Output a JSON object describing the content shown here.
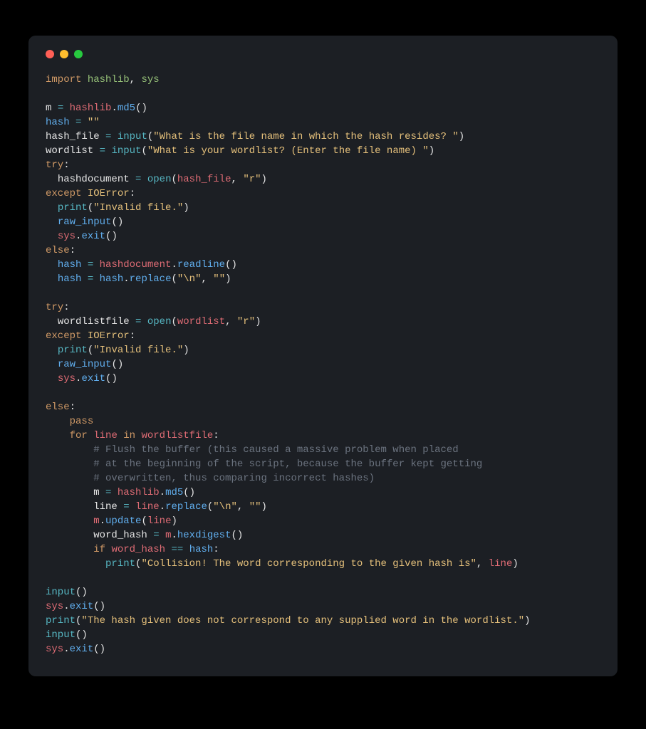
{
  "window": {
    "dots": [
      "close",
      "minimize",
      "zoom"
    ]
  },
  "code": {
    "l01_import": "import",
    "l01_mod1": "hashlib",
    "l01_mod2": "sys",
    "l03_m": "m",
    "l03_eq": "=",
    "l03_hashlib": "hashlib",
    "l03_md5": "md5",
    "l04_hash": "hash",
    "l04_eq": "=",
    "l04_str": "\"\"",
    "l05_hashfile": "hash_file",
    "l05_eq": "=",
    "l05_input": "input",
    "l05_str": "\"What is the file name in which the hash resides? \"",
    "l06_wordlist": "wordlist",
    "l06_eq": "=",
    "l06_input": "input",
    "l06_str": "\"What is your wordlist? (Enter the file name) \"",
    "l07_try": "try",
    "l08_hashdoc": "hashdocument",
    "l08_eq": "=",
    "l08_open": "open",
    "l08_arg1": "hash_file",
    "l08_arg2": "\"r\"",
    "l09_except": "except",
    "l09_ioe": "IOError",
    "l10_print": "print",
    "l10_str": "\"Invalid file.\"",
    "l11_rawinput": "raw_input",
    "l12_sys": "sys",
    "l12_exit": "exit",
    "l13_else": "else",
    "l14_hash": "hash",
    "l14_eq": "=",
    "l14_hashdoc": "hashdocument",
    "l14_readline": "readline",
    "l15_hash": "hash",
    "l15_eq": "=",
    "l15_hashref": "hash",
    "l15_replace": "replace",
    "l15_a": "\"\\n\"",
    "l15_b": "\"\"",
    "l17_try": "try",
    "l18_wlf": "wordlistfile",
    "l18_eq": "=",
    "l18_open": "open",
    "l18_arg1": "wordlist",
    "l18_arg2": "\"r\"",
    "l19_except": "except",
    "l19_ioe": "IOError",
    "l20_print": "print",
    "l20_str": "\"Invalid file.\"",
    "l21_rawinput": "raw_input",
    "l22_sys": "sys",
    "l22_exit": "exit",
    "l24_else": "else",
    "l25_pass": "pass",
    "l26_for": "for",
    "l26_line": "line",
    "l26_in": "in",
    "l26_wlf": "wordlistfile",
    "l27_com": "# Flush the buffer (this caused a massive problem when placed",
    "l28_com": "# at the beginning of the script, because the buffer kept getting",
    "l29_com": "# overwritten, thus comparing incorrect hashes)",
    "l30_m": "m",
    "l30_eq": "=",
    "l30_hashlib": "hashlib",
    "l30_md5": "md5",
    "l31_line": "line",
    "l31_eq": "=",
    "l31_lineref": "line",
    "l31_replace": "replace",
    "l31_a": "\"\\n\"",
    "l31_b": "\"\"",
    "l32_m": "m",
    "l32_update": "update",
    "l32_arg": "line",
    "l33_wh": "word_hash",
    "l33_eq": "=",
    "l33_m": "m",
    "l33_hex": "hexdigest",
    "l34_if": "if",
    "l34_wh": "word_hash",
    "l34_eqeq": "==",
    "l34_hash": "hash",
    "l35_print": "print",
    "l35_str": "\"Collision! The word corresponding to the given hash is\"",
    "l35_line": "line",
    "l37_input": "input",
    "l38_sys": "sys",
    "l38_exit": "exit",
    "l39_print": "print",
    "l39_str": "\"The hash given does not correspond to any supplied word in the wordlist.\"",
    "l40_input": "input",
    "l41_sys": "sys",
    "l41_exit": "exit"
  }
}
